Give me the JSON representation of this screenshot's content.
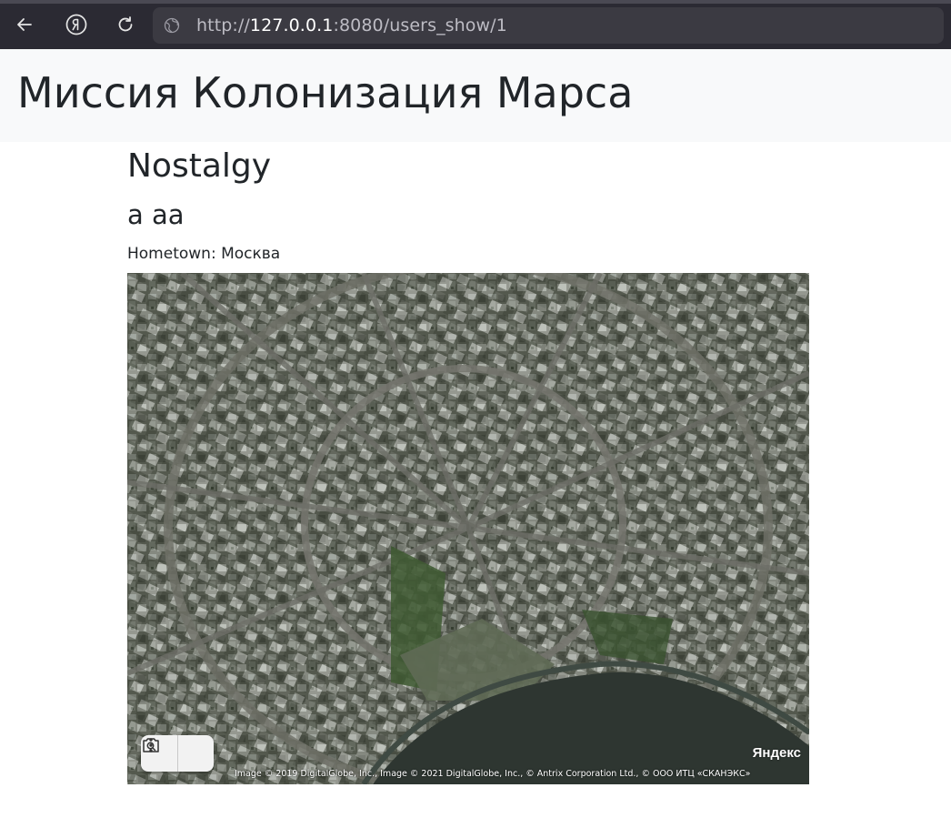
{
  "browser": {
    "url_prefix": "http://",
    "url_host": "127.0.0.1",
    "url_rest": ":8080/users_show/1",
    "icons": [
      "back-arrow-icon",
      "yandex-icon",
      "reload-icon",
      "globe-icon"
    ]
  },
  "header": {
    "title": "Миссия Колонизация Марса"
  },
  "profile": {
    "name": "Nostalgy",
    "subtitle": "a aa",
    "hometown": "Hometown: Москва"
  },
  "map": {
    "logo": "Яндекс",
    "copyright": "Image © 2019 DigitalGlobe, Inc., Image © 2021 DigitalGlobe, Inc., © Antrix Corporation Ltd., © ООО ИТЦ «СКАНЭКС»",
    "controls": [
      "camera-search-icon",
      "more-vertical-icon"
    ]
  }
}
